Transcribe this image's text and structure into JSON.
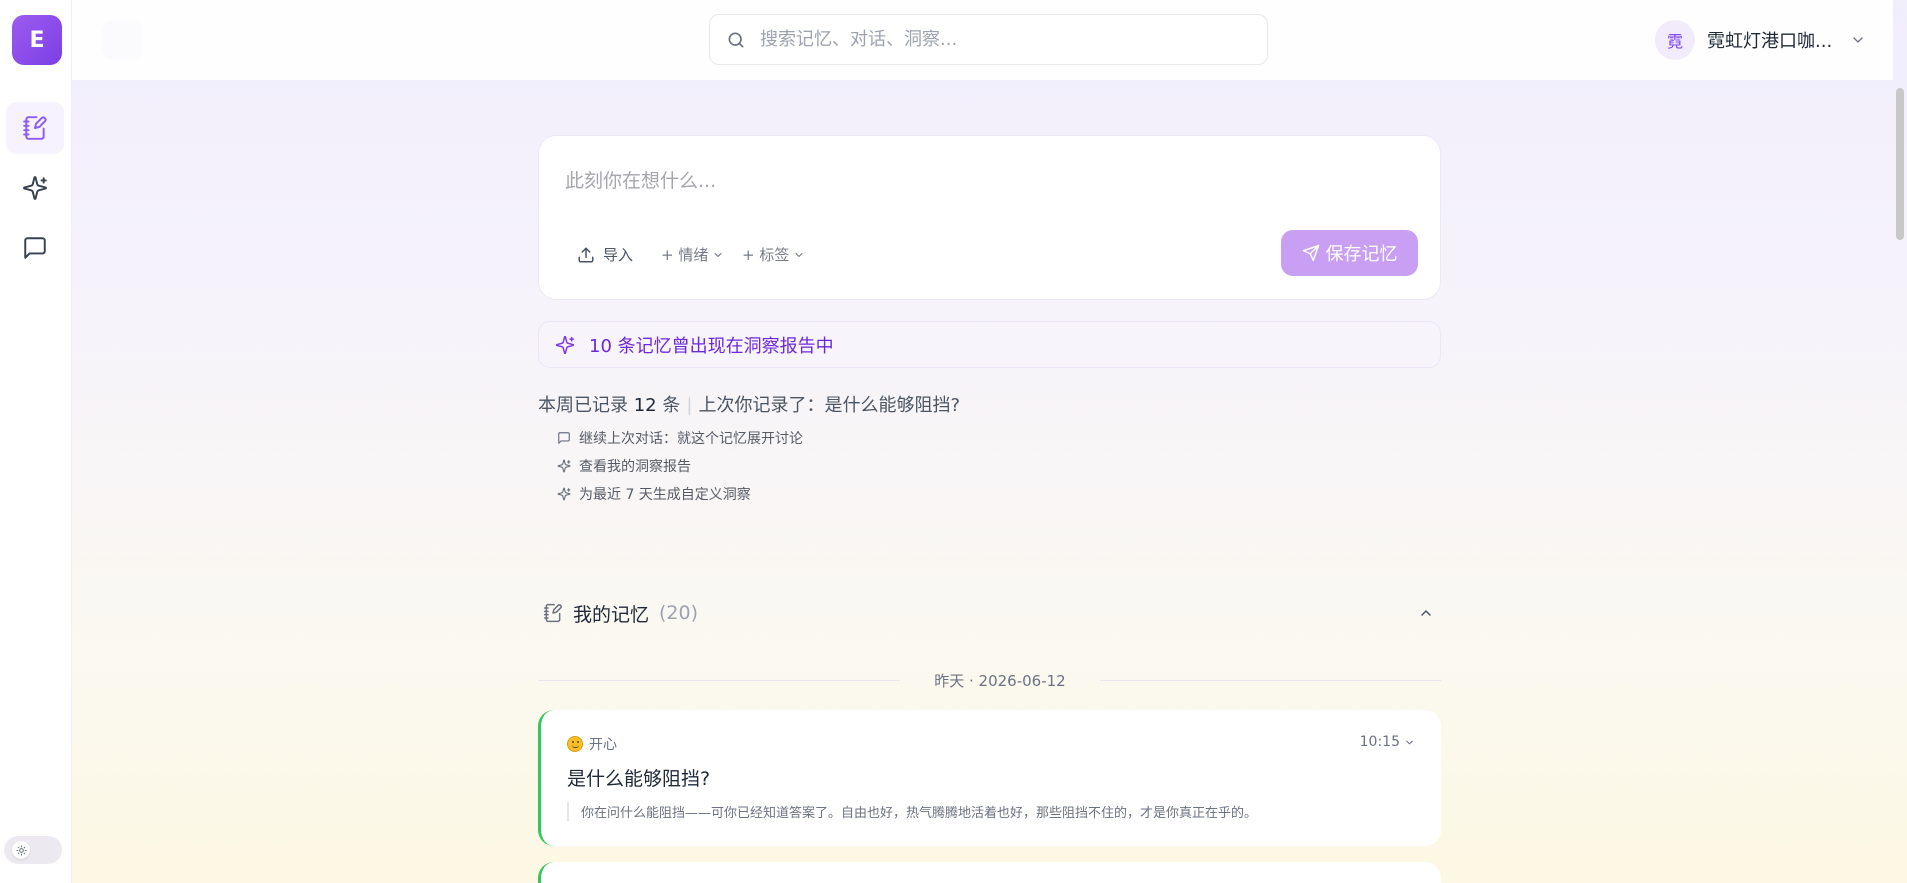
{
  "app": {
    "logo_letter": "E",
    "accent": "#8b5cf6"
  },
  "sidebar": {
    "items": [
      {
        "name": "memories",
        "icon": "notebook-pen-icon",
        "active": true
      },
      {
        "name": "insights",
        "icon": "sparkles-icon",
        "active": false
      },
      {
        "name": "chats",
        "icon": "message-square-icon",
        "active": false
      }
    ],
    "theme_icon": "sun-icon"
  },
  "search": {
    "placeholder": "搜索记忆、对话、洞察..."
  },
  "user": {
    "avatar_char": "霓",
    "name": "霓虹灯港口咖..."
  },
  "composer": {
    "placeholder": "此刻你在想什么...",
    "import_label": "导入",
    "emotion_label": "+ 情绪",
    "tags_label": "+ 标签",
    "save_label": "保存记忆"
  },
  "insight_banner": "10 条记忆曾出现在洞察报告中",
  "summary": {
    "prefix": "本周已记录",
    "count": "12",
    "suffix": "条",
    "last_label": "上次你记录了：是什么能够阻挡?"
  },
  "suggestions": [
    "继续上次对话：就这个记忆展开讨论",
    "查看我的洞察报告",
    "为最近 7 天生成自定义洞察"
  ],
  "memories": {
    "title": "我的记忆",
    "count": "(20)",
    "date_divider": "昨天 · 2026-06-12",
    "items": [
      {
        "emotion": "开心",
        "time": "10:15",
        "title": "是什么能够阻挡?",
        "quote": "你在问什么能阻挡——可你已经知道答案了。自由也好，热气腾腾地活着也好，那些阻挡不住的，才是你真正在乎的。",
        "accent": "#34c759"
      }
    ]
  }
}
